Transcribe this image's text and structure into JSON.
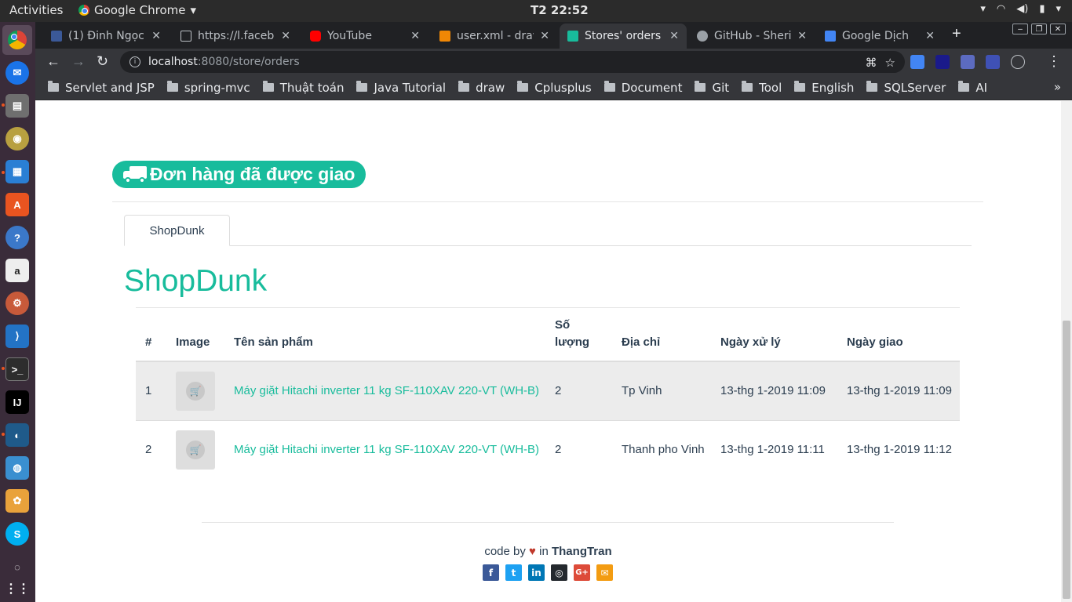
{
  "system": {
    "activities": "Activities",
    "app_name": "Google Chrome",
    "clock": "T2 22:52"
  },
  "tabs": [
    {
      "label": "(1) Đinh Ngọc",
      "favicon_color": "#3b5998",
      "favicon": "facebook-icon"
    },
    {
      "label": "https://l.faceb",
      "favicon_color": "#bdc1c6",
      "favicon": "page-icon"
    },
    {
      "label": "YouTube",
      "favicon_color": "#ff0000",
      "favicon": "youtube-icon"
    },
    {
      "label": "user.xml - drav",
      "favicon_color": "#f08705",
      "favicon": "drawio-icon"
    },
    {
      "label": "Stores' orders",
      "favicon_color": "#18bc9c",
      "favicon": "store-icon"
    },
    {
      "label": "GitHub - Sherif",
      "favicon_color": "#9aa0a6",
      "favicon": "github-icon"
    },
    {
      "label": "Google Dịch",
      "favicon_color": "#4285f4",
      "favicon": "translate-icon"
    }
  ],
  "address": {
    "host": "localhost",
    "path": ":8080/store/orders"
  },
  "bookmarks": [
    "Servlet and JSP",
    "spring-mvc",
    "Thuật toán",
    "Java Tutorial",
    "draw",
    "Cplusplus",
    "Document",
    "Git",
    "Tool",
    "English",
    "SQLServer",
    "AI"
  ],
  "page": {
    "title": "Đơn hàng đã được giao",
    "store_tab": "ShopDunk",
    "store_heading": "ShopDunk",
    "table": {
      "headers": [
        "#",
        "Image",
        "Tên sản phẩm",
        "Số lượng",
        "Địa chỉ",
        "Ngày xử lý",
        "Ngày giao"
      ],
      "rows": [
        {
          "num": "1",
          "product": "Máy giặt Hitachi inverter 11 kg SF-110XAV 220-VT (WH-B)",
          "qty": "2",
          "address": "Tp Vinh",
          "processed": "13-thg 1-2019 11:09",
          "delivered": "13-thg 1-2019 11:09"
        },
        {
          "num": "2",
          "product": "Máy giặt Hitachi inverter 11 kg SF-110XAV 220-VT (WH-B)",
          "qty": "2",
          "address": "Thanh pho Vinh",
          "processed": "13-thg 1-2019 11:11",
          "delivered": "13-thg 1-2019 11:12"
        }
      ]
    },
    "footer": {
      "prefix": "code by",
      "middle": "in",
      "author": "ThangTran"
    },
    "socials": [
      {
        "name": "facebook",
        "color": "#3b5998",
        "glyph": "f"
      },
      {
        "name": "twitter",
        "color": "#1da1f2",
        "glyph": "t"
      },
      {
        "name": "linkedin",
        "color": "#0077b5",
        "glyph": "in"
      },
      {
        "name": "github",
        "color": "#24292e",
        "glyph": "◎"
      },
      {
        "name": "google-plus",
        "color": "#dd4b39",
        "glyph": "G+"
      },
      {
        "name": "email",
        "color": "#f39c12",
        "glyph": "✉"
      }
    ]
  },
  "colors": {
    "accent": "#18bc9c",
    "heart": "#c0392b"
  }
}
